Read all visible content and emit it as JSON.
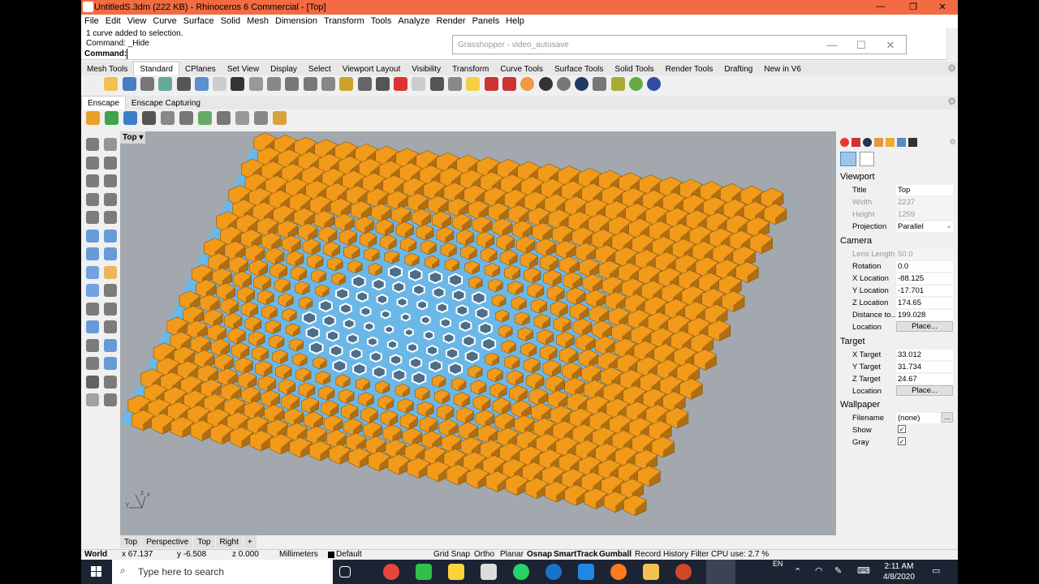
{
  "window": {
    "title": "UntitledS.3dm (222 KB) - Rhinoceros 6 Commercial - [Top]",
    "min": "—",
    "max": "❐",
    "close": "✕"
  },
  "menu": [
    "File",
    "Edit",
    "View",
    "Curve",
    "Surface",
    "Solid",
    "Mesh",
    "Dimension",
    "Transform",
    "Tools",
    "Analyze",
    "Render",
    "Panels",
    "Help"
  ],
  "command": {
    "history1": "1 curve added to selection.",
    "history2": "Command: _Hide",
    "prompt": "Command:"
  },
  "grasshopper": {
    "title": "Grasshopper - video_autosave"
  },
  "toolbar_tabs": [
    "Mesh Tools",
    "Standard",
    "CPlanes",
    "Set View",
    "Display",
    "Select",
    "Viewport Layout",
    "Visibility",
    "Transform",
    "Curve Tools",
    "Surface Tools",
    "Solid Tools",
    "Render Tools",
    "Drafting",
    "New in V6"
  ],
  "enscape_tabs": [
    "Enscape",
    "Enscape Capturing"
  ],
  "viewport": {
    "label": "Top"
  },
  "viewport_tabs": [
    "Top",
    "Perspective",
    "Top",
    "Right"
  ],
  "status": {
    "cplane": "World",
    "x": "x 67.137",
    "y": "y -6.508",
    "z": "z 0.000",
    "units": "Millimeters",
    "layer": "Default",
    "grid_snap": "Grid Snap",
    "ortho": "Ortho",
    "planar": "Planar",
    "osnap": "Osnap",
    "smarttrack": "SmartTrack",
    "gumball": "Gumball",
    "record": "Record History",
    "filter": "Filter",
    "cpu": "CPU use: 2.7 %"
  },
  "properties": {
    "viewport_header": "Viewport",
    "title_label": "Title",
    "title_value": "Top",
    "width_label": "Width",
    "width_value": "2237",
    "height_label": "Height",
    "height_value": "1259",
    "projection_label": "Projection",
    "projection_value": "Parallel",
    "camera_header": "Camera",
    "lens_label": "Lens Length",
    "lens_value": "50.0",
    "rotation_label": "Rotation",
    "rotation_value": "0.0",
    "xloc_label": "X Location",
    "xloc_value": "-88.125",
    "yloc_label": "Y Location",
    "yloc_value": "-17.701",
    "zloc_label": "Z Location",
    "zloc_value": "174.65",
    "dist_label": "Distance to...",
    "dist_value": "199.028",
    "loc_label": "Location",
    "place": "Place...",
    "target_header": "Target",
    "tx_label": "X Target",
    "tx_value": "33.012",
    "ty_label": "Y Target",
    "ty_value": "31.734",
    "tz_label": "Z Target",
    "tz_value": "24.67",
    "tloc_label": "Location",
    "wallpaper_header": "Wallpaper",
    "filename_label": "Filename",
    "filename_value": "(none)",
    "browse": "...",
    "show_label": "Show",
    "gray_label": "Gray"
  },
  "taskbar": {
    "search_placeholder": "Type here to search",
    "lang": "EN",
    "time": "2:11 AM",
    "date": "4/8/2020"
  },
  "colors": {
    "title_bar": "#f26b43",
    "viewport_bg": "#a3a8ae",
    "mesh_orange": "#f29a1a",
    "mesh_blue": "#6bb8e8",
    "taskbar": "#1c2433"
  }
}
